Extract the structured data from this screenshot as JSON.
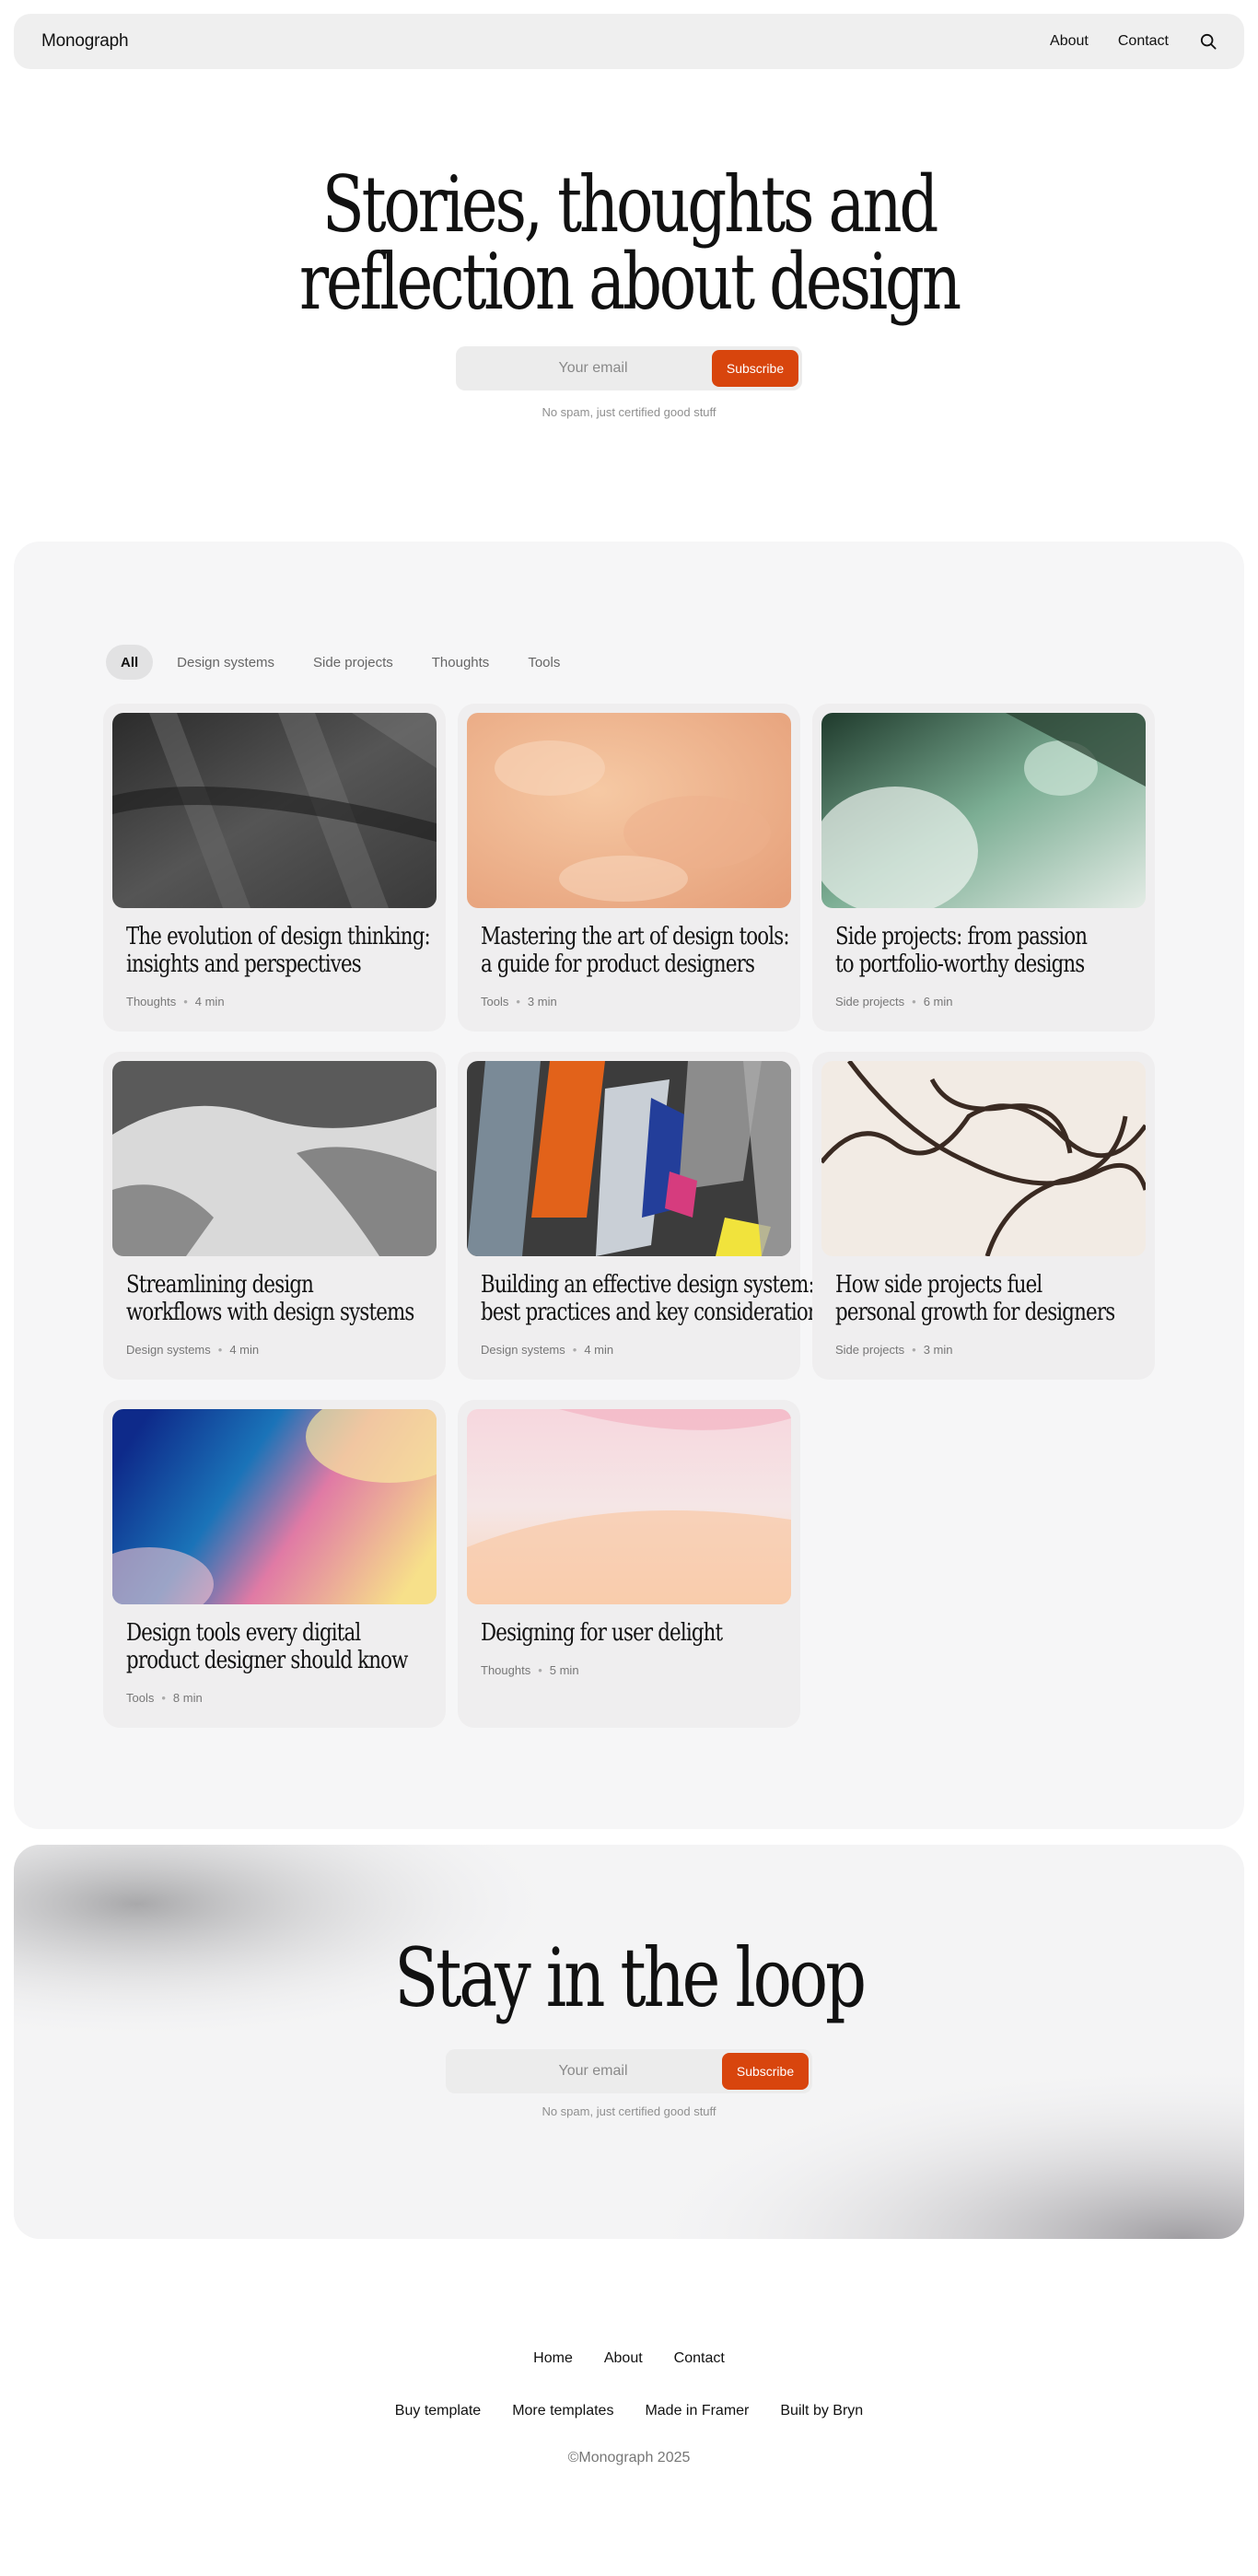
{
  "nav": {
    "brand": "Monograph",
    "links": [
      "About",
      "Contact"
    ],
    "search_icon": "search-icon"
  },
  "hero": {
    "title_line1": "Stories, thoughts and",
    "title_line2": "reflection about design",
    "email_placeholder": "Your email",
    "subscribe_label": "Subscribe",
    "note": "No spam, just certified good stuff"
  },
  "filters": [
    "All",
    "Design systems",
    "Side projects",
    "Thoughts",
    "Tools"
  ],
  "articles": [
    {
      "title_line1": "The evolution of design thinking:",
      "title_line2": "insights and perspectives",
      "category": "Thoughts",
      "read_time": "4 min"
    },
    {
      "title_line1": "Mastering the art of design tools:",
      "title_line2": "a guide for product designers",
      "category": "Tools",
      "read_time": "3 min"
    },
    {
      "title_line1": "Side projects: from passion",
      "title_line2": "to portfolio-worthy designs",
      "category": "Side projects",
      "read_time": "6 min"
    },
    {
      "title_line1": "Streamlining design",
      "title_line2": "workflows with design systems",
      "category": "Design systems",
      "read_time": "4 min"
    },
    {
      "title_line1": "Building an effective design system:",
      "title_line2": "best practices and key considerations",
      "category": "Design systems",
      "read_time": "4 min"
    },
    {
      "title_line1": "How side projects fuel",
      "title_line2": "personal growth for designers",
      "category": "Side projects",
      "read_time": "3 min"
    },
    {
      "title_line1": "Design tools every digital",
      "title_line2": "product designer should know",
      "category": "Tools",
      "read_time": "8 min"
    },
    {
      "title_line1": "Designing for user delight",
      "title_line2": "",
      "category": "Thoughts",
      "read_time": "5 min"
    }
  ],
  "loop": {
    "title": "Stay in the loop",
    "email_placeholder": "Your email",
    "subscribe_label": "Subscribe",
    "note": "No spam, just certified good stuff"
  },
  "footer": {
    "primary_links": [
      "Home",
      "About",
      "Contact"
    ],
    "secondary_links": [
      "Buy template",
      "More templates",
      "Made in Framer",
      "Built by Bryn"
    ],
    "copyright": "©Monograph 2025"
  },
  "colors": {
    "accent": "#d8450d",
    "nav_bg": "#efefef",
    "card_bg": "#efeeef",
    "panel_bg": "#f6f6f7"
  }
}
